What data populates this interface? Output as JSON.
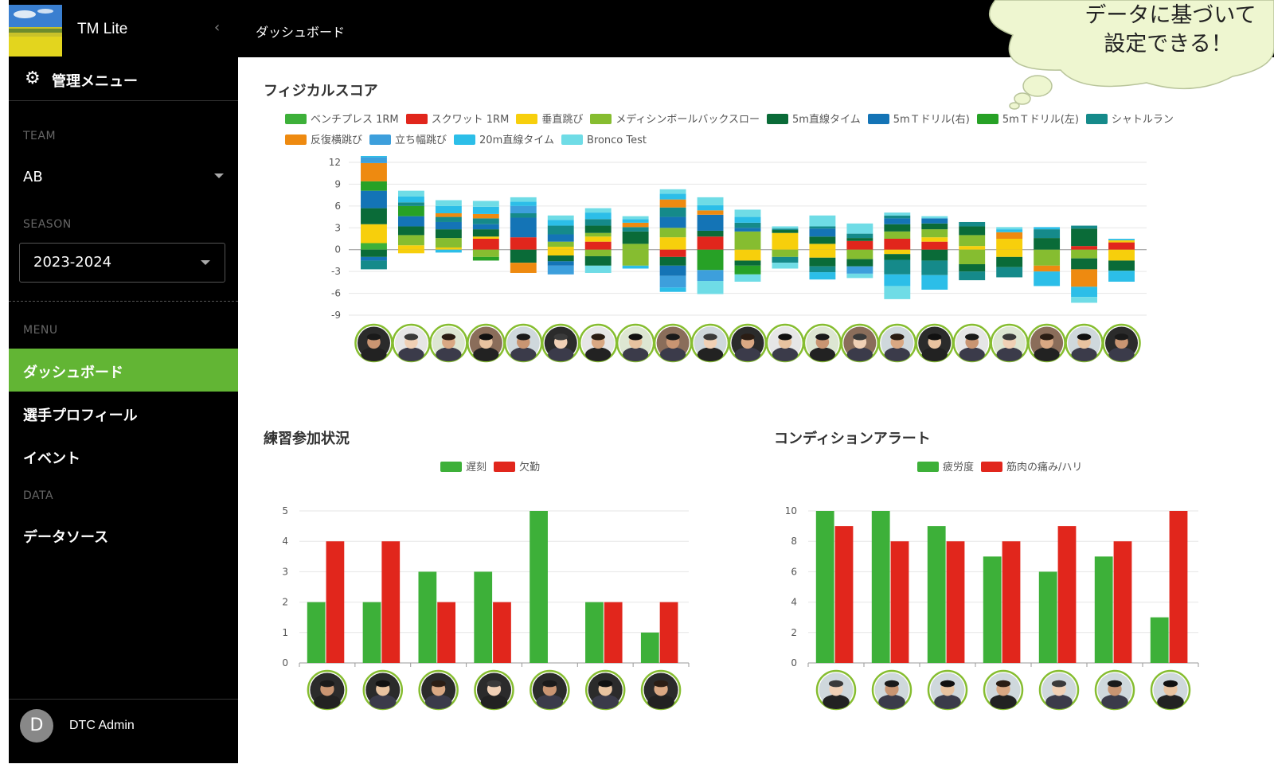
{
  "app": {
    "brand": "TM Lite",
    "page_title": "ダッシュボード"
  },
  "sidebar": {
    "admin_menu": "管理メニュー",
    "team_label": "TEAM",
    "team_value": "AB",
    "season_label": "SEASON",
    "season_value": "2023-2024",
    "menu_label": "MENU",
    "items": [
      {
        "label": "ダッシュボード",
        "active": true
      },
      {
        "label": "選手プロフィール"
      },
      {
        "label": "イベント"
      }
    ],
    "data_label": "DATA",
    "data_items": [
      {
        "label": "データソース"
      }
    ],
    "user": {
      "initial": "D",
      "name": "DTC Admin"
    }
  },
  "callout": {
    "line1": "データに基づいて",
    "line2": "設定できる！"
  },
  "colors": {
    "accent": "#62b534",
    "red": "#e1261c",
    "black": "#000000"
  },
  "chart_data": [
    {
      "type": "bar",
      "title": "フィジカルスコア",
      "stacked": true,
      "ylim": [
        -9,
        12
      ],
      "yticks": [
        12,
        9,
        6,
        3,
        0,
        -3,
        -6,
        -9
      ],
      "legend_position": "top",
      "grid": true,
      "player_count": 21,
      "series": [
        {
          "name": "ベンチプレス 1RM",
          "color": "#3db039"
        },
        {
          "name": "スクワット 1RM",
          "color": "#e1261c"
        },
        {
          "name": "垂直跳び",
          "color": "#f7cf0c"
        },
        {
          "name": "メディシンボールバックスロー",
          "color": "#86bd30"
        },
        {
          "name": "5m直線タイム",
          "color": "#0a6b38"
        },
        {
          "name": "5mＴドリル(右)",
          "color": "#1474b6"
        },
        {
          "name": "5mＴドリル(左)",
          "color": "#27a126"
        },
        {
          "name": "シャトルラン",
          "color": "#158a8a"
        },
        {
          "name": "反復横跳び",
          "color": "#ee8a10"
        },
        {
          "name": "立ち幅跳び",
          "color": "#3d9fdc"
        },
        {
          "name": "20m直線タイム",
          "color": "#2cbee8"
        },
        {
          "name": "Bronco Test",
          "color": "#6fdce6"
        }
      ],
      "players_pos": [
        [
          0.9,
          0,
          2.6,
          0,
          2.2,
          2.4,
          1.3,
          0,
          2.5,
          0.8,
          0.8,
          0.5
        ],
        [
          0,
          0,
          0.6,
          1.4,
          1.2,
          1.4,
          1.4,
          0.5,
          0,
          0,
          0.8,
          0.8
        ],
        [
          0,
          0,
          0.3,
          1.3,
          1.2,
          1.0,
          0,
          0.7,
          0.5,
          0,
          1.0,
          0.8
        ],
        [
          0,
          1.5,
          0.3,
          0,
          1.0,
          0.7,
          0,
          0.8,
          0.6,
          0,
          1.0,
          0.8
        ],
        [
          0,
          1.7,
          0,
          0,
          0,
          2.7,
          0,
          0.6,
          0,
          1.0,
          0.6,
          0.6
        ],
        [
          0,
          0,
          0.4,
          0.7,
          0,
          1.0,
          0,
          1.2,
          0,
          0,
          0.8,
          0.6
        ],
        [
          0,
          1.1,
          0.7,
          0.5,
          1.0,
          0,
          0,
          0.9,
          0,
          0,
          0.9,
          0.6
        ],
        [
          0,
          0,
          0,
          0.8,
          1.7,
          0,
          0,
          0.6,
          0.6,
          0,
          0.5,
          0.4
        ],
        [
          0,
          0,
          1.7,
          1.3,
          0,
          1.5,
          0,
          1.3,
          1.1,
          0,
          0.8,
          0.6
        ],
        [
          0,
          1.8,
          0,
          0,
          0.8,
          2.2,
          0,
          0,
          0.6,
          0,
          0.7,
          1.1
        ],
        [
          0,
          0,
          0,
          2.5,
          0,
          0.5,
          0,
          0.7,
          0,
          0,
          0.8,
          1.0
        ],
        [
          0,
          0,
          2.3,
          0,
          0.4,
          0,
          0,
          0.2,
          0,
          0,
          0,
          0.3
        ],
        [
          0,
          0,
          0.8,
          0,
          1.0,
          1.1,
          0,
          0.3,
          0,
          0,
          0,
          1.5
        ],
        [
          0,
          1.2,
          0,
          0,
          0.4,
          0,
          0,
          0.6,
          0,
          0,
          0,
          1.4
        ],
        [
          0,
          1.5,
          0,
          1.0,
          1.0,
          0.8,
          0,
          0.4,
          0,
          0,
          0,
          0.4
        ],
        [
          0,
          1.1,
          0.6,
          1.1,
          0.8,
          0.7,
          0,
          0,
          0,
          0,
          0,
          0.3
        ],
        [
          0,
          0,
          0.5,
          1.5,
          1.2,
          0,
          0,
          0.6,
          0,
          0,
          0,
          0
        ],
        [
          0,
          0,
          1.5,
          0,
          0,
          0,
          0,
          0,
          0.9,
          0,
          0.4,
          0.3
        ],
        [
          0,
          0,
          0,
          0,
          1.6,
          0,
          0,
          1.2,
          0,
          0,
          0.3,
          0
        ],
        [
          0,
          0.5,
          0,
          0,
          2.4,
          0,
          0,
          0.4,
          0,
          0,
          0,
          0
        ],
        [
          0,
          1.0,
          0.3,
          0,
          0,
          0,
          0,
          0,
          0,
          0,
          0.2,
          0
        ]
      ],
      "players_neg": [
        [
          0,
          0,
          0,
          0,
          1.0,
          0.5,
          0,
          1.2,
          0,
          0,
          0,
          0
        ],
        [
          0,
          0,
          0.5,
          0,
          0,
          0,
          0,
          0,
          0,
          0,
          0,
          0
        ],
        [
          0,
          0,
          0,
          0,
          0,
          0,
          0,
          0,
          0,
          0,
          0.4,
          0
        ],
        [
          0,
          0,
          0,
          1.0,
          0,
          0,
          0.5,
          0,
          0,
          0,
          0,
          0
        ],
        [
          0,
          0,
          0,
          0,
          1.8,
          0,
          0,
          0,
          1.4,
          0,
          0,
          0
        ],
        [
          0,
          0,
          0.8,
          0,
          0.8,
          0.6,
          0,
          0,
          0,
          1.2,
          0,
          0
        ],
        [
          0,
          0,
          0,
          0.9,
          1.3,
          0,
          0,
          0,
          0,
          0,
          0,
          1.0
        ],
        [
          0,
          0,
          0,
          2.2,
          0,
          0,
          0,
          0,
          0,
          0,
          0.4,
          0
        ],
        [
          0,
          1.0,
          0,
          0,
          1.2,
          1.4,
          0,
          0,
          0,
          1.6,
          0.6,
          0
        ],
        [
          0,
          0,
          0,
          0,
          0,
          0,
          2.8,
          0,
          0,
          1.5,
          0,
          1.8
        ],
        [
          0,
          0,
          1.5,
          0,
          0.7,
          0,
          1.2,
          0,
          0,
          0,
          0,
          1.0
        ],
        [
          0,
          0,
          0,
          1.0,
          0,
          0,
          0,
          0.8,
          0,
          0,
          0,
          0.8
        ],
        [
          0,
          0,
          1.1,
          0,
          1.2,
          0,
          0,
          0.8,
          0,
          0,
          1.0,
          0
        ],
        [
          0,
          0,
          0,
          1.3,
          1.0,
          0,
          0,
          0,
          0,
          1.0,
          0,
          0.6
        ],
        [
          0,
          0,
          0.6,
          0,
          0.8,
          0,
          0,
          2.0,
          0,
          0,
          1.6,
          1.8
        ],
        [
          0,
          0,
          0,
          0,
          1.5,
          0,
          0,
          2.0,
          0,
          0,
          2.0,
          0
        ],
        [
          0,
          0,
          0,
          2.0,
          1.0,
          0,
          0,
          1.2,
          0,
          0,
          0,
          0
        ],
        [
          0,
          0,
          1.0,
          0,
          1.4,
          0,
          0,
          1.4,
          0,
          0,
          0,
          0
        ],
        [
          0,
          0,
          0,
          2.2,
          0,
          0,
          0,
          0,
          0.8,
          0,
          2.0,
          0
        ],
        [
          0,
          0,
          0,
          1.2,
          1.5,
          0,
          0,
          0,
          2.4,
          0,
          1.4,
          0.8
        ],
        [
          0,
          0,
          1.5,
          0,
          1.4,
          0,
          0,
          0,
          0,
          0,
          1.5,
          0
        ]
      ]
    },
    {
      "type": "bar",
      "title": "練習参加状況",
      "legend_position": "top",
      "ylim": [
        0,
        5
      ],
      "yticks": [
        5,
        4,
        3,
        2,
        1,
        0
      ],
      "grid": true,
      "series": [
        {
          "name": "遅刻",
          "color": "#3db039",
          "values": [
            2,
            2,
            3,
            3,
            5,
            2,
            1
          ]
        },
        {
          "name": "欠勤",
          "color": "#e1261c",
          "values": [
            4,
            4,
            2,
            2,
            0,
            2,
            2
          ]
        }
      ]
    },
    {
      "type": "bar",
      "title": "コンディションアラート",
      "legend_position": "top",
      "ylim": [
        0,
        10
      ],
      "yticks": [
        10,
        8,
        6,
        4,
        2,
        0
      ],
      "grid": true,
      "series": [
        {
          "name": "疲労度",
          "color": "#3db039",
          "values": [
            10,
            10,
            9,
            7,
            6,
            7,
            3
          ]
        },
        {
          "name": "筋肉の痛み/ハリ",
          "color": "#e1261c",
          "values": [
            9,
            8,
            8,
            8,
            9,
            8,
            10
          ]
        }
      ]
    }
  ]
}
